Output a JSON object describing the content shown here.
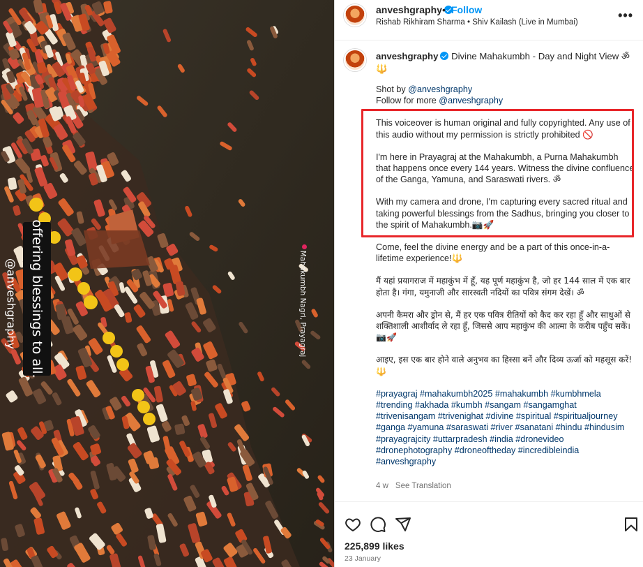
{
  "media": {
    "overlay_caption": "offering blessings to all.",
    "overlay_handle": "@anveshgraphy",
    "location_label": "Mahakumbh Nagri, Prayagraj"
  },
  "post_header": {
    "username": "anveshgraphy",
    "dot": "•",
    "follow_label": "Follow",
    "audio": "Rishab Rikhiram Sharma • Shiv Kailash (Live in Mumbai)",
    "more_label": "•••"
  },
  "caption": {
    "username": "anveshgraphy",
    "title": "Divine Mahakumbh - Day and Night View ॐ 🔱",
    "shot_by_prefix": "Shot by ",
    "shot_by_mention": "@anveshgraphy",
    "follow_more_prefix": "Follow for more ",
    "follow_more_mention": "@anveshgraphy",
    "para1": "This voiceover is human original and fully copyrighted. Any use of this audio without my permission is strictly prohibited 🚫",
    "para2": "I'm here in Prayagraj at the Mahakumbh, a Purna Mahakumbh that happens once every 144 years. Witness the divine confluence of the Ganga, Yamuna, and Saraswati rivers. ॐ",
    "para3": "With my camera and drone, I'm capturing every sacred ritual and taking powerful blessings from the Sadhus, bringing you closer to the spirit of Mahakumbh.📷🚀",
    "para4": "Come, feel the divine energy and be a part of this once-in-a-lifetime experience!🔱",
    "hindi1": "मैं यहां प्रयागराज में महाकुंभ में हूँ, यह पूर्ण महाकुंभ है, जो हर 144 साल में एक बार होता है। गंगा, यमुनाजी और सारस्वती नदियों का पवित्र संगम देखें। ॐ",
    "hindi2": "अपनी कैमरा और ड्रोन से, मैं हर एक पवित्र रीतियों को कैद कर रहा हूँ और साधुओं से शक्तिशाली आशीर्वाद ले रहा हूँ, जिससे आप महाकुंभ की आत्मा के करीब पहुँच सकें।📷🚀",
    "hindi3": "आइए, इस एक बार होने वाले अनुभव का हिस्सा बनें और दिव्य ऊर्जा को महसूस करें!🔱",
    "hashtags": "#prayagraj #mahakumbh2025 #mahakumbh #kumbhmela #trending #akhada #kumbh #sangam #sangamghat #trivenisangam #trivenighat #divine #spiritual #spiritualjourney #ganga #yamuna #saraswati #river #sanatani #hindu #hindusim #prayagrajcity #uttarpradesh #india #dronevideo #dronephotography #droneoftheday #incredibleindia #anveshgraphy",
    "age": "4 w",
    "see_translation": "See Translation"
  },
  "footer": {
    "likes": "225,899 likes",
    "date": "23 January"
  },
  "icons": [
    "heart-icon",
    "comment-icon",
    "share-icon",
    "bookmark-icon"
  ],
  "colors": {
    "link": "#00376b",
    "follow": "#0095f6",
    "highlight_box": "#e8262a",
    "water": "#2f2a22"
  }
}
